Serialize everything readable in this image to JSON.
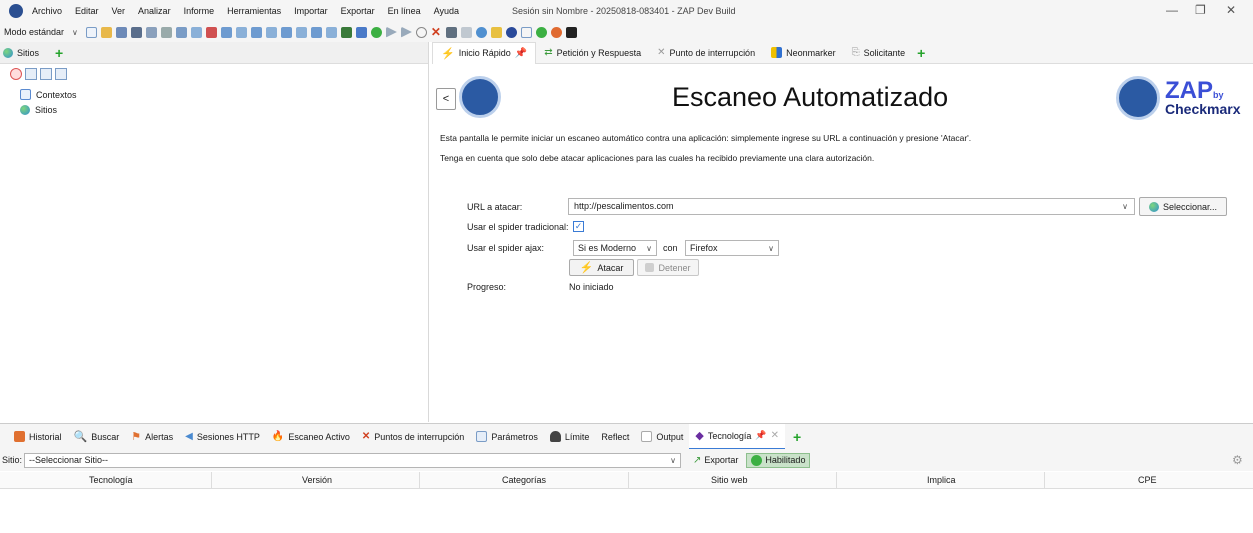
{
  "menu": {
    "items": [
      "Archivo",
      "Editar",
      "Ver",
      "Analizar",
      "Informe",
      "Herramientas",
      "Importar",
      "Exportar",
      "En línea",
      "Ayuda"
    ],
    "window_title": "Sesión sin Nombre - 20250818-083401 - ZAP Dev Build"
  },
  "toolbar": {
    "mode": "Modo estándar"
  },
  "sites": {
    "tab_label": "Sitios",
    "tree": [
      {
        "label": "Contextos",
        "icon": "contexts-icon"
      },
      {
        "label": "Sitios",
        "icon": "globe-icon"
      }
    ]
  },
  "workspace": {
    "tabs": [
      {
        "label": "Inicio Rápido",
        "icon": "bolt-icon",
        "active": true
      },
      {
        "label": "Petición y Respuesta",
        "icon": "exchange-icon"
      },
      {
        "label": "Punto de interrupción",
        "icon": "breakpoint-icon"
      },
      {
        "label": "Neonmarker",
        "icon": "marker-icon"
      },
      {
        "label": "Solicitante",
        "icon": "requester-icon"
      }
    ]
  },
  "quickstart": {
    "back_label": "<",
    "title": "Escaneo Automatizado",
    "brand_zap": "ZAP",
    "brand_by": "by",
    "brand_checkmarx": "Checkmarx",
    "desc1": "Esta pantalla le permite iniciar un escaneo automático contra una aplicación: simplemente ingrese su URL a continuación y presione 'Atacar'.",
    "desc2": "Tenga en cuenta que solo debe atacar aplicaciones para las cuales ha recibido previamente una clara autorización.",
    "url_label": "URL a atacar:",
    "url_value": "http://pescalimentos.com",
    "select_label": "Seleccionar...",
    "spider_label": "Usar el spider tradicional:",
    "spider_checked": true,
    "ajax_label": "Usar el spider ajax:",
    "ajax_mode": "Si es Moderno",
    "ajax_with": "con",
    "ajax_browser": "Firefox",
    "attack_label": "Atacar",
    "stop_label": "Detener",
    "progress_label": "Progreso:",
    "progress_value": "No iniciado"
  },
  "bottom": {
    "tabs": [
      {
        "label": "Historial",
        "icon": "history-icon"
      },
      {
        "label": "Buscar",
        "icon": "search-icon"
      },
      {
        "label": "Alertas",
        "icon": "flag-icon"
      },
      {
        "label": "Sesiones HTTP",
        "icon": "sessions-icon"
      },
      {
        "label": "Escaneo Activo",
        "icon": "fire-icon"
      },
      {
        "label": "Puntos de interrupción",
        "icon": "breakpoints-icon"
      },
      {
        "label": "Parámetros",
        "icon": "params-icon"
      },
      {
        "label": "Límite",
        "icon": "limit-icon"
      },
      {
        "label": "Reflect",
        "icon": ""
      },
      {
        "label": "Output",
        "icon": "output-icon"
      },
      {
        "label": "Tecnología",
        "icon": "technology-icon",
        "active": true
      }
    ],
    "site_label": "Sitio:",
    "site_value": "--Seleccionar Sitio--",
    "export_label": "Exportar",
    "enabled_label": "Habilitado",
    "columns": [
      "Tecnología",
      "Versión",
      "Categorías",
      "Sitio web",
      "Implica",
      "CPE"
    ]
  },
  "colors": {
    "accent": "#3a7bd5",
    "zap_blue": "#2b5aa3",
    "plus_green": "#25a32c",
    "brand_text": "#3b4fd6"
  }
}
